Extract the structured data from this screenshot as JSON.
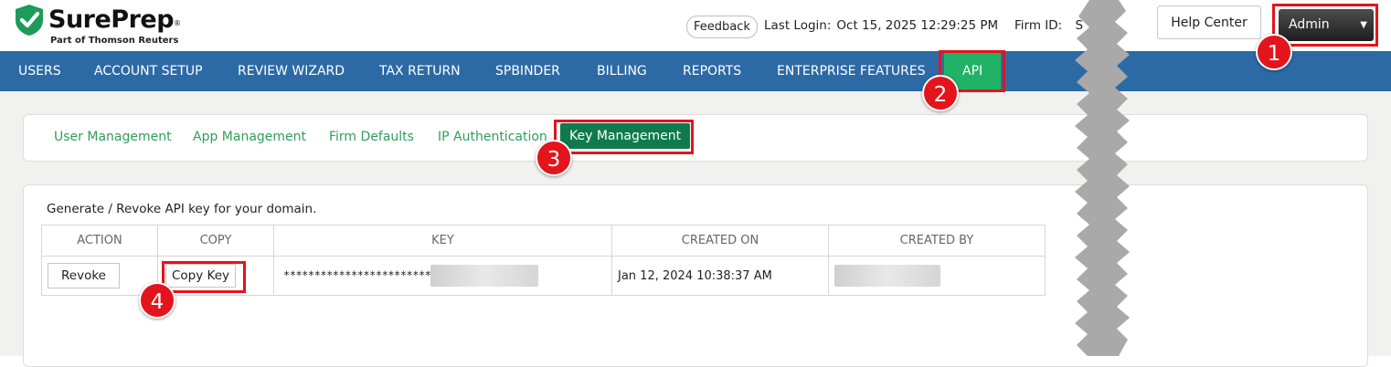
{
  "brand": {
    "name": "SurePrep",
    "reg_mark": "®",
    "tagline": "Part of Thomson Reuters",
    "color": "#1e9b5a"
  },
  "header": {
    "feedback_label": "Feedback",
    "last_login_label": "Last Login:",
    "last_login_value": "Oct 15, 2025 12:29:25 PM",
    "firm_id_label": "Firm ID:",
    "firm_id_value": "S",
    "help_center_label": "Help Center",
    "user_menu_label": "Admin"
  },
  "nav": {
    "items": [
      {
        "label": "USERS"
      },
      {
        "label": "ACCOUNT SETUP"
      },
      {
        "label": "REVIEW WIZARD"
      },
      {
        "label": "TAX RETURN"
      },
      {
        "label": "SPBINDER"
      },
      {
        "label": "BILLING"
      },
      {
        "label": "REPORTS"
      },
      {
        "label": "ENTERPRISE FEATURES"
      },
      {
        "label": "API",
        "active": true
      }
    ]
  },
  "subnav": {
    "items": [
      {
        "label": "User Management"
      },
      {
        "label": "App Management"
      },
      {
        "label": "Firm Defaults"
      },
      {
        "label": "IP Authentication"
      },
      {
        "label": "Key Management",
        "active": true
      }
    ]
  },
  "panel": {
    "description": "Generate / Revoke API key for your domain.",
    "table": {
      "columns": [
        "ACTION",
        "COPY",
        "KEY",
        "CREATED ON",
        "CREATED BY"
      ],
      "rows": [
        {
          "action_label": "Revoke",
          "copy_label": "Copy Key",
          "key_masked": "************************",
          "created_on": "Jan 12, 2024 10:38:37 AM",
          "created_by": ""
        }
      ]
    }
  },
  "callouts": [
    "1",
    "2",
    "3",
    "4"
  ],
  "colors": {
    "navbar": "#2c6aa6",
    "nav_active": "#20b267",
    "subnav_link": "#2f9f5b",
    "subnav_active": "#0e7a4e",
    "highlight": "#e4141c"
  }
}
